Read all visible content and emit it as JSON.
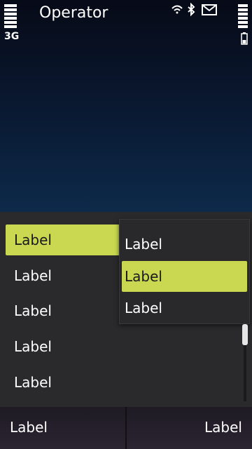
{
  "status_bar": {
    "operator": "Operator",
    "network": "3G",
    "icons": [
      "wifi-icon",
      "bluetooth-icon",
      "mail-icon",
      "battery-icon"
    ]
  },
  "list": {
    "items": [
      {
        "label": "Label",
        "selected": true
      },
      {
        "label": "Label",
        "selected": false
      },
      {
        "label": "Label",
        "selected": false
      },
      {
        "label": "Label",
        "selected": false
      },
      {
        "label": "Label",
        "selected": false
      }
    ]
  },
  "popup": {
    "items": [
      {
        "label": "Label",
        "selected": false
      },
      {
        "label": "Label",
        "selected": true
      },
      {
        "label": "Label",
        "selected": false
      }
    ]
  },
  "softkeys": {
    "left": "Label",
    "right": "Label"
  },
  "colors": {
    "highlight": "#c9d850",
    "panel": "#2a2a2c",
    "wallpaper_bottom": "#0d2a4a"
  }
}
